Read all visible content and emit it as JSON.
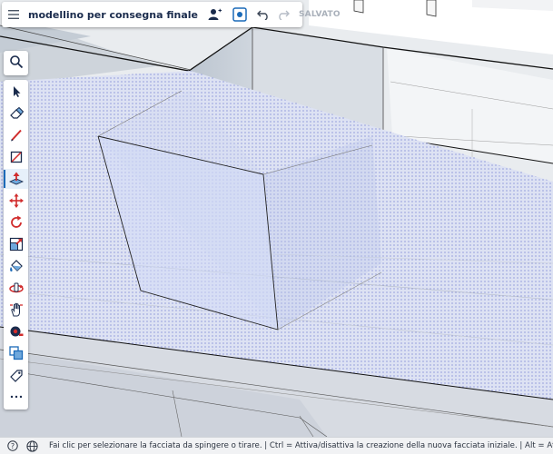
{
  "header": {
    "title": "modellino per consegna finale",
    "saved_label": "SALVATO",
    "icons": [
      "menu-icon",
      "collaborators-icon",
      "scene-icon",
      "undo-icon",
      "redo-icon"
    ]
  },
  "search": {
    "icon": "magnifier-icon"
  },
  "tools": [
    {
      "name": "select",
      "icon": "arrow-icon"
    },
    {
      "name": "eraser",
      "icon": "eraser-icon"
    },
    {
      "name": "line",
      "icon": "pencil-icon"
    },
    {
      "name": "rectangle",
      "icon": "rectangle-icon"
    },
    {
      "name": "push-pull",
      "icon": "push-pull-icon",
      "active": true
    },
    {
      "name": "move",
      "icon": "move-icon"
    },
    {
      "name": "rotate",
      "icon": "rotate-icon"
    },
    {
      "name": "scale",
      "icon": "scale-icon"
    },
    {
      "name": "paint-bucket",
      "icon": "paint-bucket-icon"
    },
    {
      "name": "orbit",
      "icon": "orbit-icon"
    },
    {
      "name": "pan",
      "icon": "hand-icon"
    },
    {
      "name": "tape-measure",
      "icon": "tape-icon"
    },
    {
      "name": "components",
      "icon": "components-icon"
    },
    {
      "name": "tag",
      "icon": "tag-icon"
    },
    {
      "name": "more",
      "icon": "more-icon"
    }
  ],
  "status": {
    "text": "Fai clic per selezionare la facciata da spingere o tirare. | Ctrl = Attiva/disattiva la creazione della nuova facciata iniziale. | Alt = Attiva/disattiva"
  },
  "colors": {
    "accent": "#1b6ab8",
    "title": "#1a2b4c",
    "toolbar_bg": "#ffffff",
    "status_bg": "#f1f2f4"
  }
}
